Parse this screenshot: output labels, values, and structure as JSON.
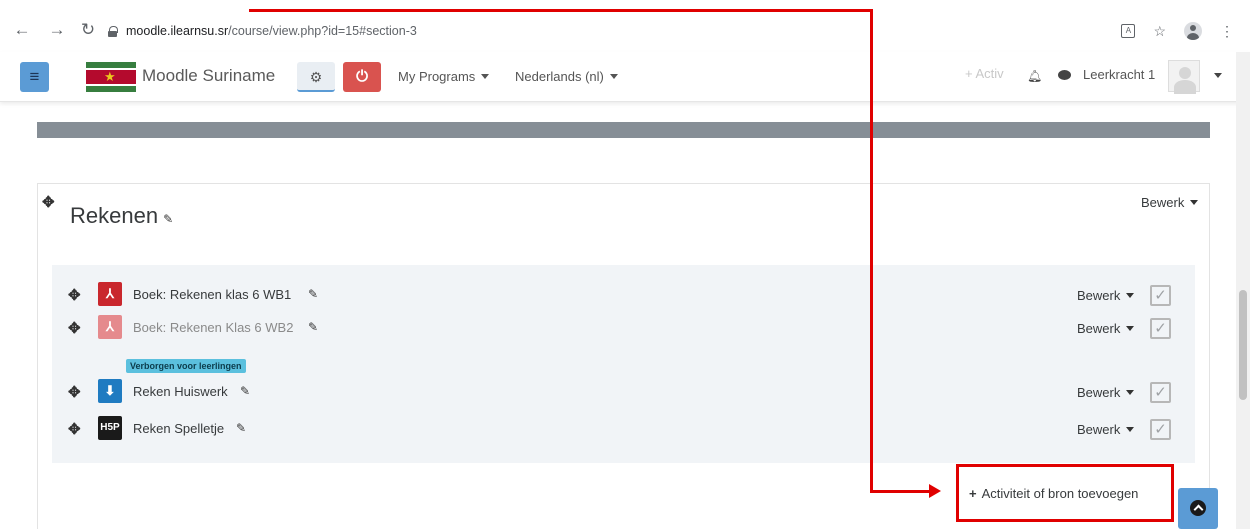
{
  "browser": {
    "url_host": "moodle.ilearnsu.sr",
    "url_path": "/course/view.php?id=15#section-3"
  },
  "navbar": {
    "site_name": "Moodle Suriname",
    "menu_programs": "My Programs",
    "menu_language": "Nederlands (nl)",
    "activity_hint": "+ Activ",
    "user_name": "Leerkracht 1"
  },
  "section": {
    "title": "Rekenen",
    "edit_label": "Bewerk"
  },
  "activities": [
    {
      "name": "Boek: Rekenen klas 6 WB1",
      "type_icon": "pdf-icon",
      "edit_label": "Bewerk",
      "hidden": false
    },
    {
      "name": "Boek: Rekenen Klas 6 WB2",
      "type_icon": "pdf-icon",
      "edit_label": "Bewerk",
      "hidden": true
    },
    {
      "name": "Reken Huiswerk",
      "type_icon": "assignment-icon",
      "edit_label": "Bewerk",
      "hidden": false
    },
    {
      "name": "Reken Spelletje",
      "type_icon": "h5p-icon",
      "edit_label": "Bewerk",
      "hidden": false
    }
  ],
  "hidden_badge": "Verborgen voor leerlingen",
  "add_activity": {
    "label": "Activiteit of bron toevoegen"
  },
  "colors": {
    "hamburger": "#5b9bd5",
    "power": "#d9534f",
    "pdf": "#c9272d",
    "pdf_dim": "#e58a8d",
    "assignment": "#1f7bc1",
    "h5p": "#1a1a1a",
    "annotation": "#e00000",
    "badge": "#5bc0de"
  }
}
